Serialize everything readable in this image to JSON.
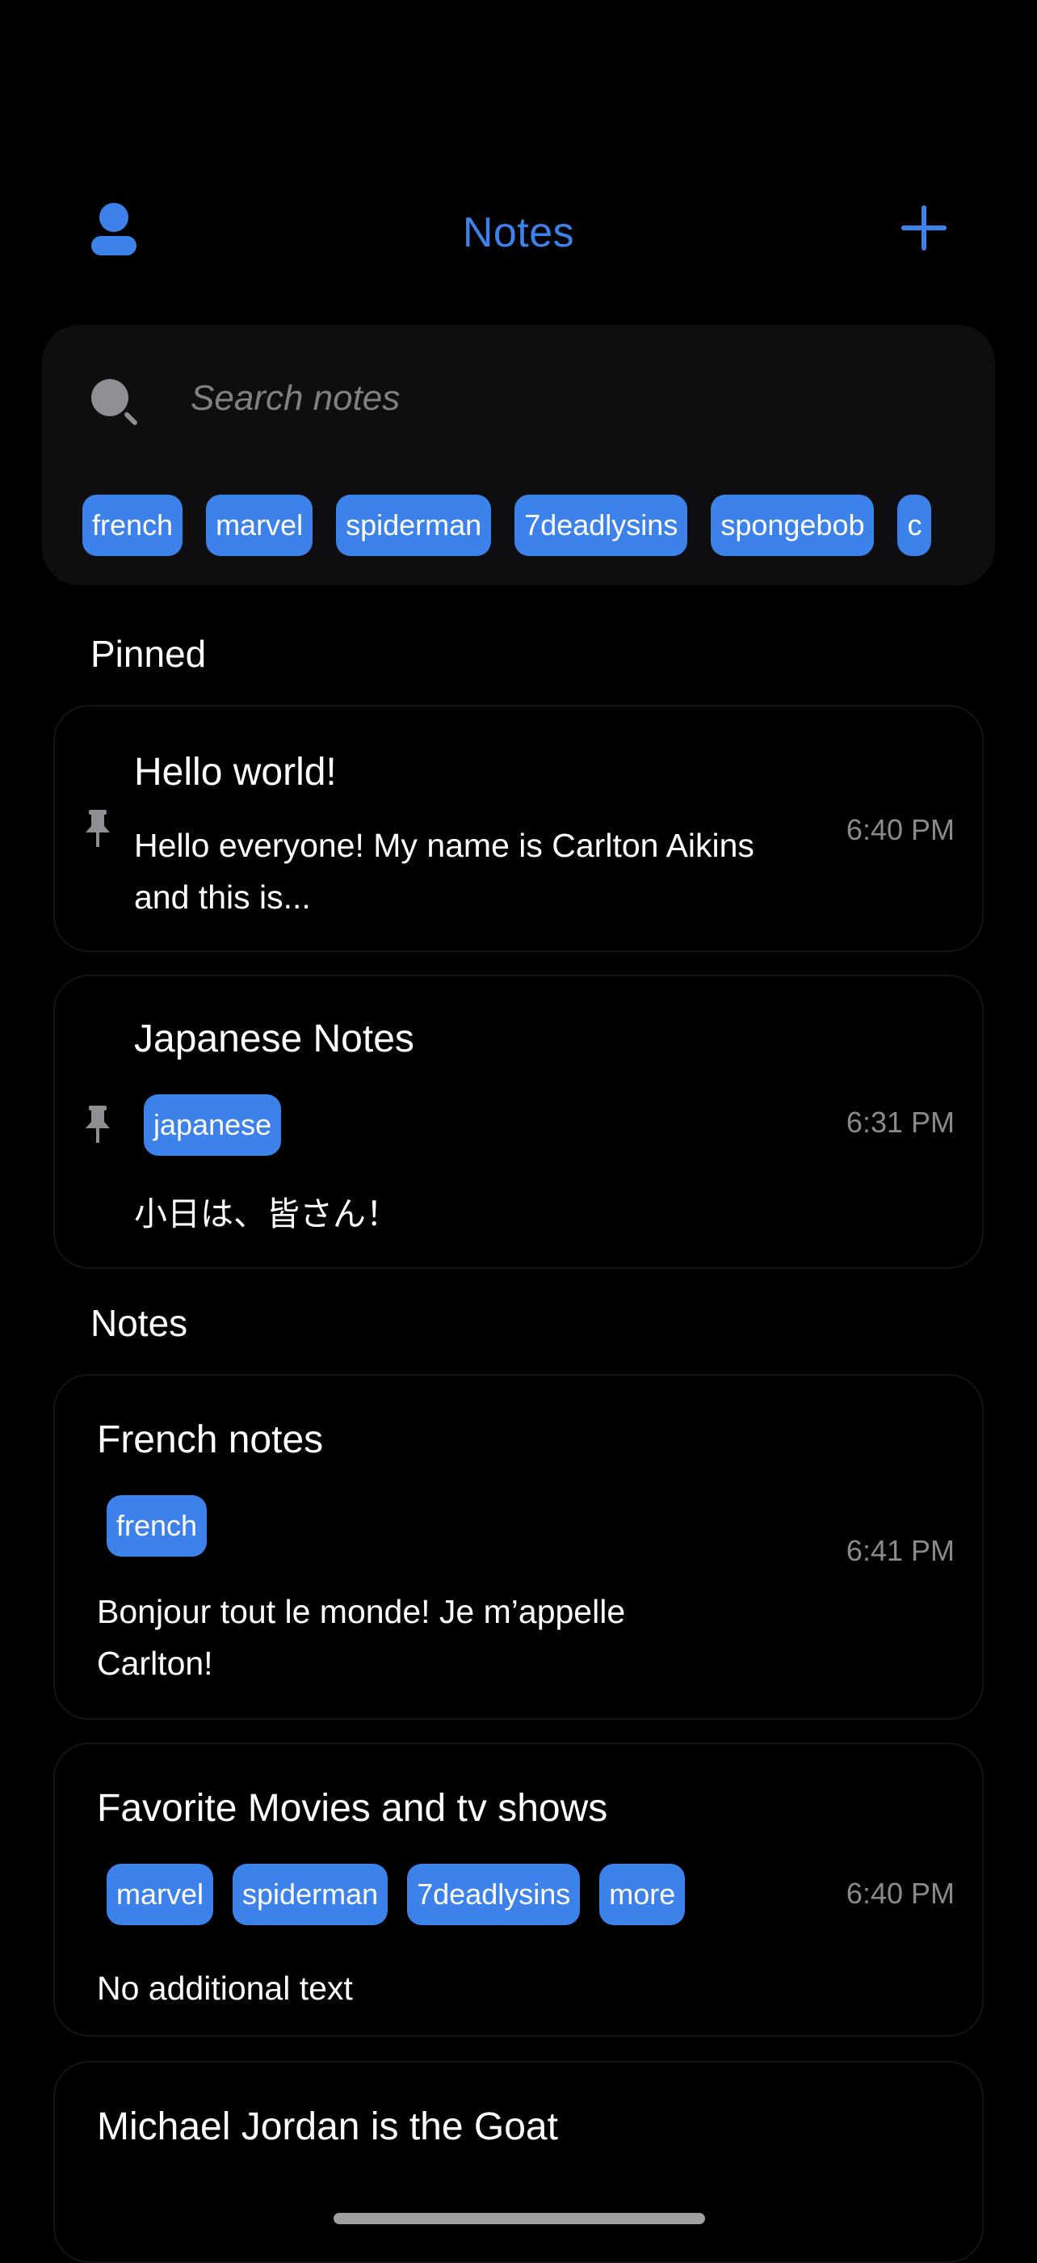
{
  "header": {
    "title": "Notes",
    "profile_icon": "person-icon",
    "add_icon": "plus-icon",
    "accent": "#3d82ea"
  },
  "search": {
    "placeholder": "Search notes",
    "icon": "search-icon",
    "tags": [
      "french",
      "marvel",
      "spiderman",
      "7deadlysins",
      "spongebob",
      "c"
    ]
  },
  "sections": {
    "pinned": "Pinned",
    "notes": "Notes"
  },
  "pinned": [
    {
      "title": "Hello world!",
      "body": "Hello everyone! My name is Carlton Aikins and this is...",
      "time": "6:40 PM",
      "pinned": true,
      "tags": []
    },
    {
      "title": "Japanese Notes",
      "body": "小日は、皆さん！",
      "time": "6:31 PM",
      "pinned": true,
      "tags": [
        "japanese"
      ]
    }
  ],
  "notes": [
    {
      "title": "French notes",
      "body": "Bonjour tout le monde! Je m’appelle Carlton!",
      "time": "6:41 PM",
      "tags": [
        "french"
      ]
    },
    {
      "title": "Favorite Movies and tv shows",
      "body": "No additional text",
      "time": "6:40 PM",
      "tags": [
        "marvel",
        "spiderman",
        "7deadlysins",
        "more"
      ]
    },
    {
      "title": "Michael Jordan is the Goat",
      "body": "",
      "time": "",
      "tags": []
    }
  ],
  "colors": {
    "background": "#000000",
    "card": "#0e0e10",
    "tag": "#3d82ea",
    "muted": "#8a8a8e"
  }
}
